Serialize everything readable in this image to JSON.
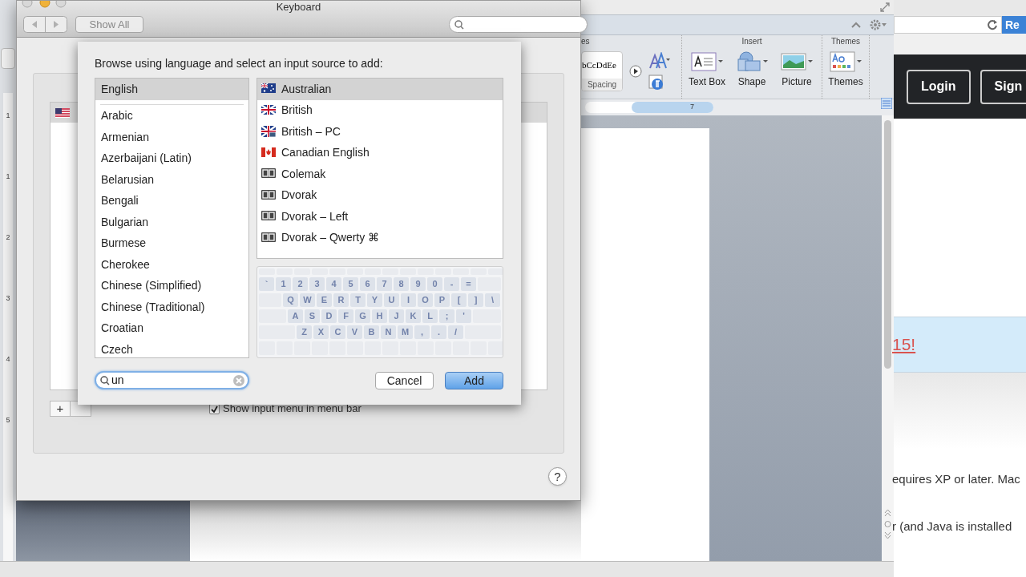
{
  "word": {
    "ribbon_groups": [
      "es",
      "Insert",
      "Themes"
    ],
    "style_preview": "bCcDdEe",
    "style_label": "Spacing",
    "ribbon_buttons": [
      {
        "label": "Text Box",
        "kind": "textbox"
      },
      {
        "label": "Shape",
        "kind": "shape"
      },
      {
        "label": "Picture",
        "kind": "picture"
      },
      {
        "label": "Themes",
        "kind": "themes"
      }
    ],
    "ruler_mark": "7",
    "vertical_ruler": [
      "1",
      "1",
      "2",
      "3",
      "4",
      "5"
    ]
  },
  "browser": {
    "address_button": "Re",
    "header_buttons": [
      "Login",
      "Sign"
    ],
    "banner_link": "15!",
    "text_lines": [
      "equires XP or later. Mac",
      "r (and Java is installed"
    ]
  },
  "window": {
    "title": "Keyboard",
    "show_all": "Show All",
    "list_button": "+",
    "checkbox": {
      "label": "Show input menu in menu bar",
      "checked": true
    },
    "help": "?"
  },
  "sheet": {
    "instruction": "Browse using language and select an input source to add:",
    "pinned_languages": [
      {
        "label": "English",
        "selected": true
      }
    ],
    "languages": [
      {
        "label": "Arabic",
        "selected": false
      },
      {
        "label": "Armenian",
        "selected": false
      },
      {
        "label": "Azerbaijani (Latin)",
        "selected": false
      },
      {
        "label": "Belarusian",
        "selected": false
      },
      {
        "label": "Bengali",
        "selected": false
      },
      {
        "label": "Bulgarian",
        "selected": false
      },
      {
        "label": "Burmese",
        "selected": false
      },
      {
        "label": "Cherokee",
        "selected": false
      },
      {
        "label": "Chinese (Simplified)",
        "selected": false
      },
      {
        "label": "Chinese (Traditional)",
        "selected": false
      },
      {
        "label": "Croatian",
        "selected": false
      },
      {
        "label": "Czech",
        "selected": false
      }
    ],
    "layouts": [
      {
        "label": "Australian",
        "kind": "flag",
        "selected": true
      },
      {
        "label": "British",
        "kind": "flag",
        "selected": false
      },
      {
        "label": "British – PC",
        "kind": "flag",
        "selected": false
      },
      {
        "label": "Canadian English",
        "kind": "flag",
        "selected": false
      },
      {
        "label": "Colemak",
        "kind": "badge",
        "selected": false
      },
      {
        "label": "Dvorak",
        "kind": "badge",
        "selected": false
      },
      {
        "label": "Dvorak – Left",
        "kind": "badge",
        "selected": false
      },
      {
        "label": "Dvorak – Qwerty ⌘",
        "kind": "badge",
        "selected": false
      }
    ],
    "keyboard_rows": [
      [
        "`",
        "1",
        "2",
        "3",
        "4",
        "5",
        "6",
        "7",
        "8",
        "9",
        "0",
        "-",
        "="
      ],
      [
        "Q",
        "W",
        "E",
        "R",
        "T",
        "Y",
        "U",
        "I",
        "O",
        "P",
        "[",
        "]",
        "\\"
      ],
      [
        "A",
        "S",
        "D",
        "F",
        "G",
        "H",
        "J",
        "K",
        "L",
        ";",
        "'"
      ],
      [
        "Z",
        "X",
        "C",
        "V",
        "B",
        "N",
        "M",
        ",",
        ".",
        "/"
      ]
    ],
    "search": {
      "value": "un"
    },
    "buttons": [
      {
        "label": "Cancel",
        "default": false
      },
      {
        "label": "Add",
        "default": true
      }
    ]
  }
}
